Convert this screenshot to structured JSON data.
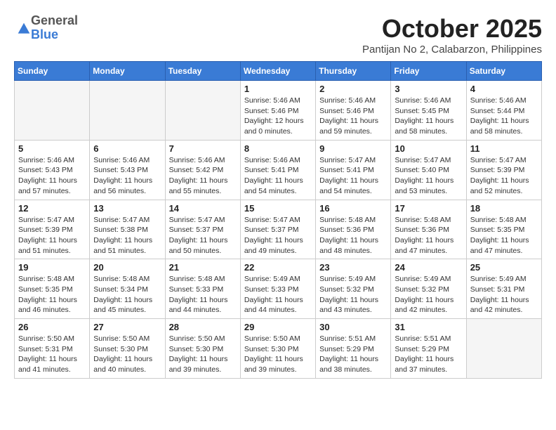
{
  "header": {
    "logo_general": "General",
    "logo_blue": "Blue",
    "month_title": "October 2025",
    "subtitle": "Pantijan No 2, Calabarzon, Philippines"
  },
  "weekdays": [
    "Sunday",
    "Monday",
    "Tuesday",
    "Wednesday",
    "Thursday",
    "Friday",
    "Saturday"
  ],
  "weeks": [
    [
      {
        "day": "",
        "sunrise": "",
        "sunset": "",
        "daylight": ""
      },
      {
        "day": "",
        "sunrise": "",
        "sunset": "",
        "daylight": ""
      },
      {
        "day": "",
        "sunrise": "",
        "sunset": "",
        "daylight": ""
      },
      {
        "day": "1",
        "sunrise": "Sunrise: 5:46 AM",
        "sunset": "Sunset: 5:46 PM",
        "daylight": "Daylight: 12 hours and 0 minutes."
      },
      {
        "day": "2",
        "sunrise": "Sunrise: 5:46 AM",
        "sunset": "Sunset: 5:46 PM",
        "daylight": "Daylight: 11 hours and 59 minutes."
      },
      {
        "day": "3",
        "sunrise": "Sunrise: 5:46 AM",
        "sunset": "Sunset: 5:45 PM",
        "daylight": "Daylight: 11 hours and 58 minutes."
      },
      {
        "day": "4",
        "sunrise": "Sunrise: 5:46 AM",
        "sunset": "Sunset: 5:44 PM",
        "daylight": "Daylight: 11 hours and 58 minutes."
      }
    ],
    [
      {
        "day": "5",
        "sunrise": "Sunrise: 5:46 AM",
        "sunset": "Sunset: 5:43 PM",
        "daylight": "Daylight: 11 hours and 57 minutes."
      },
      {
        "day": "6",
        "sunrise": "Sunrise: 5:46 AM",
        "sunset": "Sunset: 5:43 PM",
        "daylight": "Daylight: 11 hours and 56 minutes."
      },
      {
        "day": "7",
        "sunrise": "Sunrise: 5:46 AM",
        "sunset": "Sunset: 5:42 PM",
        "daylight": "Daylight: 11 hours and 55 minutes."
      },
      {
        "day": "8",
        "sunrise": "Sunrise: 5:46 AM",
        "sunset": "Sunset: 5:41 PM",
        "daylight": "Daylight: 11 hours and 54 minutes."
      },
      {
        "day": "9",
        "sunrise": "Sunrise: 5:47 AM",
        "sunset": "Sunset: 5:41 PM",
        "daylight": "Daylight: 11 hours and 54 minutes."
      },
      {
        "day": "10",
        "sunrise": "Sunrise: 5:47 AM",
        "sunset": "Sunset: 5:40 PM",
        "daylight": "Daylight: 11 hours and 53 minutes."
      },
      {
        "day": "11",
        "sunrise": "Sunrise: 5:47 AM",
        "sunset": "Sunset: 5:39 PM",
        "daylight": "Daylight: 11 hours and 52 minutes."
      }
    ],
    [
      {
        "day": "12",
        "sunrise": "Sunrise: 5:47 AM",
        "sunset": "Sunset: 5:39 PM",
        "daylight": "Daylight: 11 hours and 51 minutes."
      },
      {
        "day": "13",
        "sunrise": "Sunrise: 5:47 AM",
        "sunset": "Sunset: 5:38 PM",
        "daylight": "Daylight: 11 hours and 51 minutes."
      },
      {
        "day": "14",
        "sunrise": "Sunrise: 5:47 AM",
        "sunset": "Sunset: 5:37 PM",
        "daylight": "Daylight: 11 hours and 50 minutes."
      },
      {
        "day": "15",
        "sunrise": "Sunrise: 5:47 AM",
        "sunset": "Sunset: 5:37 PM",
        "daylight": "Daylight: 11 hours and 49 minutes."
      },
      {
        "day": "16",
        "sunrise": "Sunrise: 5:48 AM",
        "sunset": "Sunset: 5:36 PM",
        "daylight": "Daylight: 11 hours and 48 minutes."
      },
      {
        "day": "17",
        "sunrise": "Sunrise: 5:48 AM",
        "sunset": "Sunset: 5:36 PM",
        "daylight": "Daylight: 11 hours and 47 minutes."
      },
      {
        "day": "18",
        "sunrise": "Sunrise: 5:48 AM",
        "sunset": "Sunset: 5:35 PM",
        "daylight": "Daylight: 11 hours and 47 minutes."
      }
    ],
    [
      {
        "day": "19",
        "sunrise": "Sunrise: 5:48 AM",
        "sunset": "Sunset: 5:35 PM",
        "daylight": "Daylight: 11 hours and 46 minutes."
      },
      {
        "day": "20",
        "sunrise": "Sunrise: 5:48 AM",
        "sunset": "Sunset: 5:34 PM",
        "daylight": "Daylight: 11 hours and 45 minutes."
      },
      {
        "day": "21",
        "sunrise": "Sunrise: 5:48 AM",
        "sunset": "Sunset: 5:33 PM",
        "daylight": "Daylight: 11 hours and 44 minutes."
      },
      {
        "day": "22",
        "sunrise": "Sunrise: 5:49 AM",
        "sunset": "Sunset: 5:33 PM",
        "daylight": "Daylight: 11 hours and 44 minutes."
      },
      {
        "day": "23",
        "sunrise": "Sunrise: 5:49 AM",
        "sunset": "Sunset: 5:32 PM",
        "daylight": "Daylight: 11 hours and 43 minutes."
      },
      {
        "day": "24",
        "sunrise": "Sunrise: 5:49 AM",
        "sunset": "Sunset: 5:32 PM",
        "daylight": "Daylight: 11 hours and 42 minutes."
      },
      {
        "day": "25",
        "sunrise": "Sunrise: 5:49 AM",
        "sunset": "Sunset: 5:31 PM",
        "daylight": "Daylight: 11 hours and 42 minutes."
      }
    ],
    [
      {
        "day": "26",
        "sunrise": "Sunrise: 5:50 AM",
        "sunset": "Sunset: 5:31 PM",
        "daylight": "Daylight: 11 hours and 41 minutes."
      },
      {
        "day": "27",
        "sunrise": "Sunrise: 5:50 AM",
        "sunset": "Sunset: 5:30 PM",
        "daylight": "Daylight: 11 hours and 40 minutes."
      },
      {
        "day": "28",
        "sunrise": "Sunrise: 5:50 AM",
        "sunset": "Sunset: 5:30 PM",
        "daylight": "Daylight: 11 hours and 39 minutes."
      },
      {
        "day": "29",
        "sunrise": "Sunrise: 5:50 AM",
        "sunset": "Sunset: 5:30 PM",
        "daylight": "Daylight: 11 hours and 39 minutes."
      },
      {
        "day": "30",
        "sunrise": "Sunrise: 5:51 AM",
        "sunset": "Sunset: 5:29 PM",
        "daylight": "Daylight: 11 hours and 38 minutes."
      },
      {
        "day": "31",
        "sunrise": "Sunrise: 5:51 AM",
        "sunset": "Sunset: 5:29 PM",
        "daylight": "Daylight: 11 hours and 37 minutes."
      },
      {
        "day": "",
        "sunrise": "",
        "sunset": "",
        "daylight": ""
      }
    ]
  ]
}
